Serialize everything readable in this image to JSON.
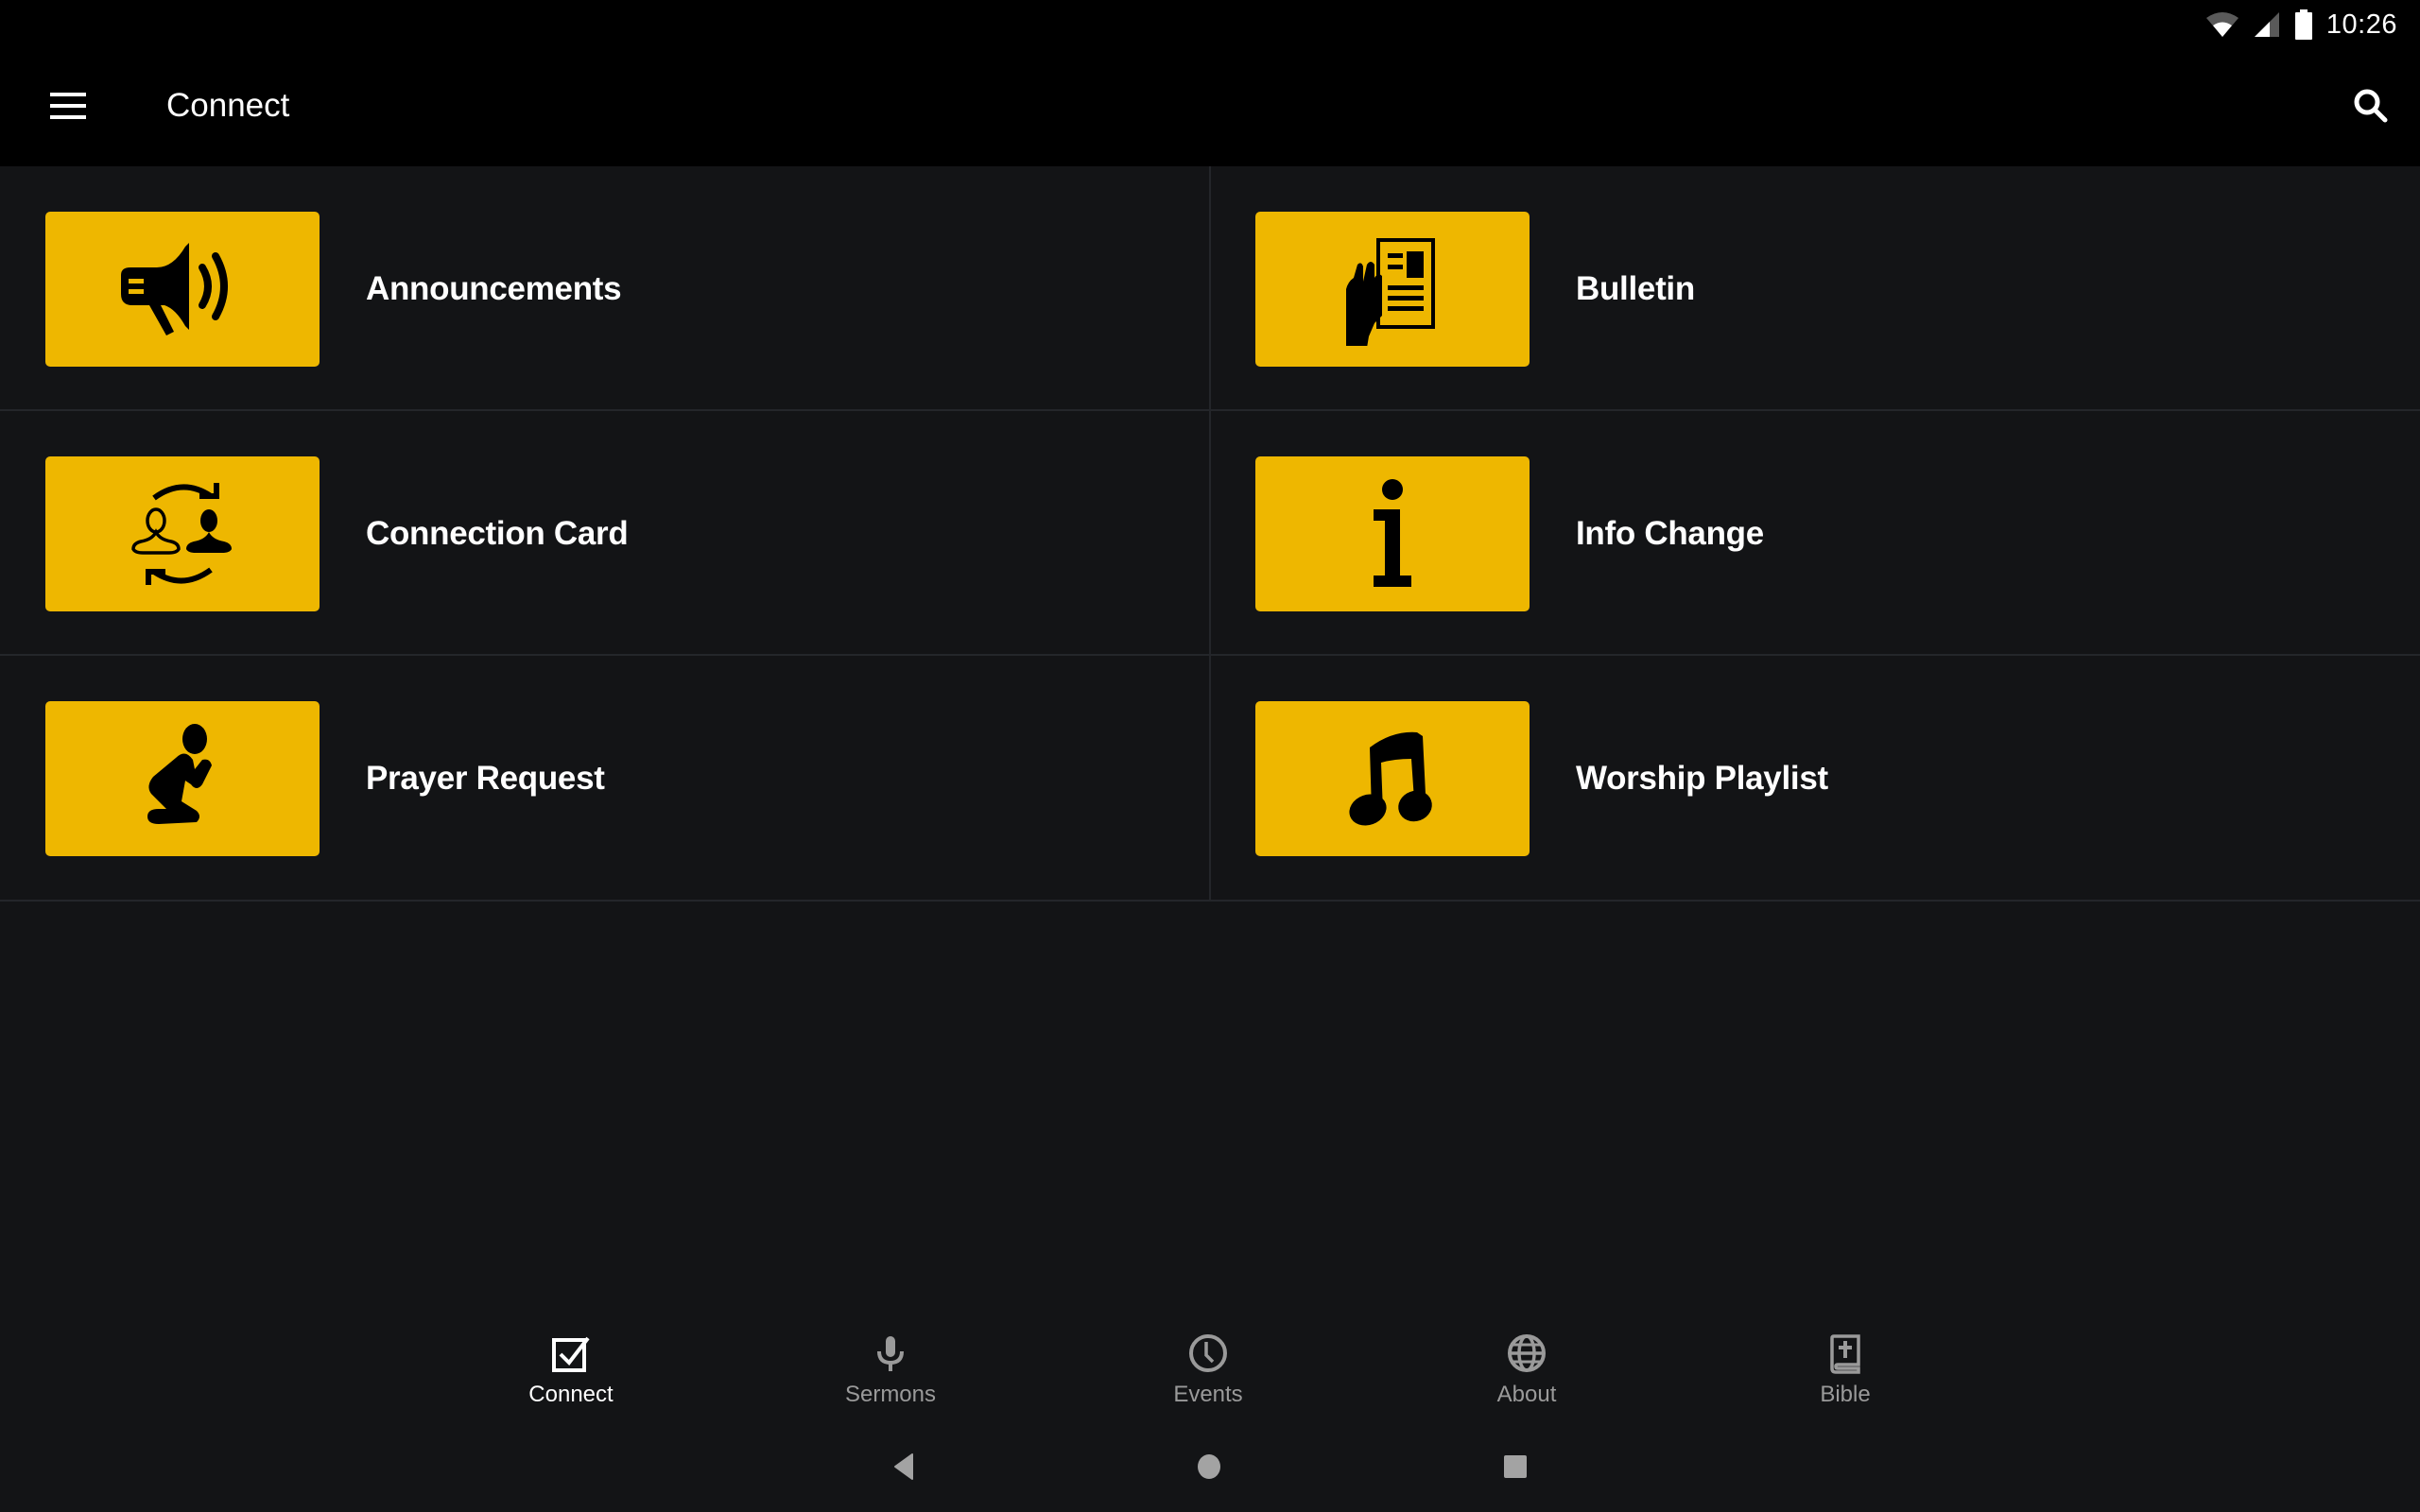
{
  "status_bar": {
    "time": "10:26",
    "icons": [
      "wifi-icon",
      "cell-signal-icon",
      "battery-icon"
    ]
  },
  "app_bar": {
    "title": "Connect",
    "menu_icon": "hamburger-menu-icon",
    "search_icon": "search-icon"
  },
  "grid": {
    "items": [
      {
        "label": "Announcements",
        "icon": "megaphone-icon"
      },
      {
        "label": "Bulletin",
        "icon": "bulletin-hand-icon"
      },
      {
        "label": "Connection Card",
        "icon": "connection-swap-icon"
      },
      {
        "label": "Info Change",
        "icon": "info-icon"
      },
      {
        "label": "Prayer Request",
        "icon": "praying-person-icon"
      },
      {
        "label": "Worship Playlist",
        "icon": "music-note-icon"
      }
    ]
  },
  "bottom_nav": {
    "items": [
      {
        "label": "Connect",
        "icon": "checkbox-icon",
        "active": true
      },
      {
        "label": "Sermons",
        "icon": "microphone-icon",
        "active": false
      },
      {
        "label": "Events",
        "icon": "clock-icon",
        "active": false
      },
      {
        "label": "About",
        "icon": "globe-icon",
        "active": false
      },
      {
        "label": "Bible",
        "icon": "bible-icon",
        "active": false
      }
    ]
  },
  "system_nav": {
    "buttons": [
      "back-icon",
      "home-icon",
      "recents-icon"
    ]
  },
  "colors": {
    "accent": "#eeb700",
    "background": "#131416",
    "app_bar": "#000000",
    "inactive_nav": "#9a9a9a",
    "active_nav": "#ffffff"
  }
}
